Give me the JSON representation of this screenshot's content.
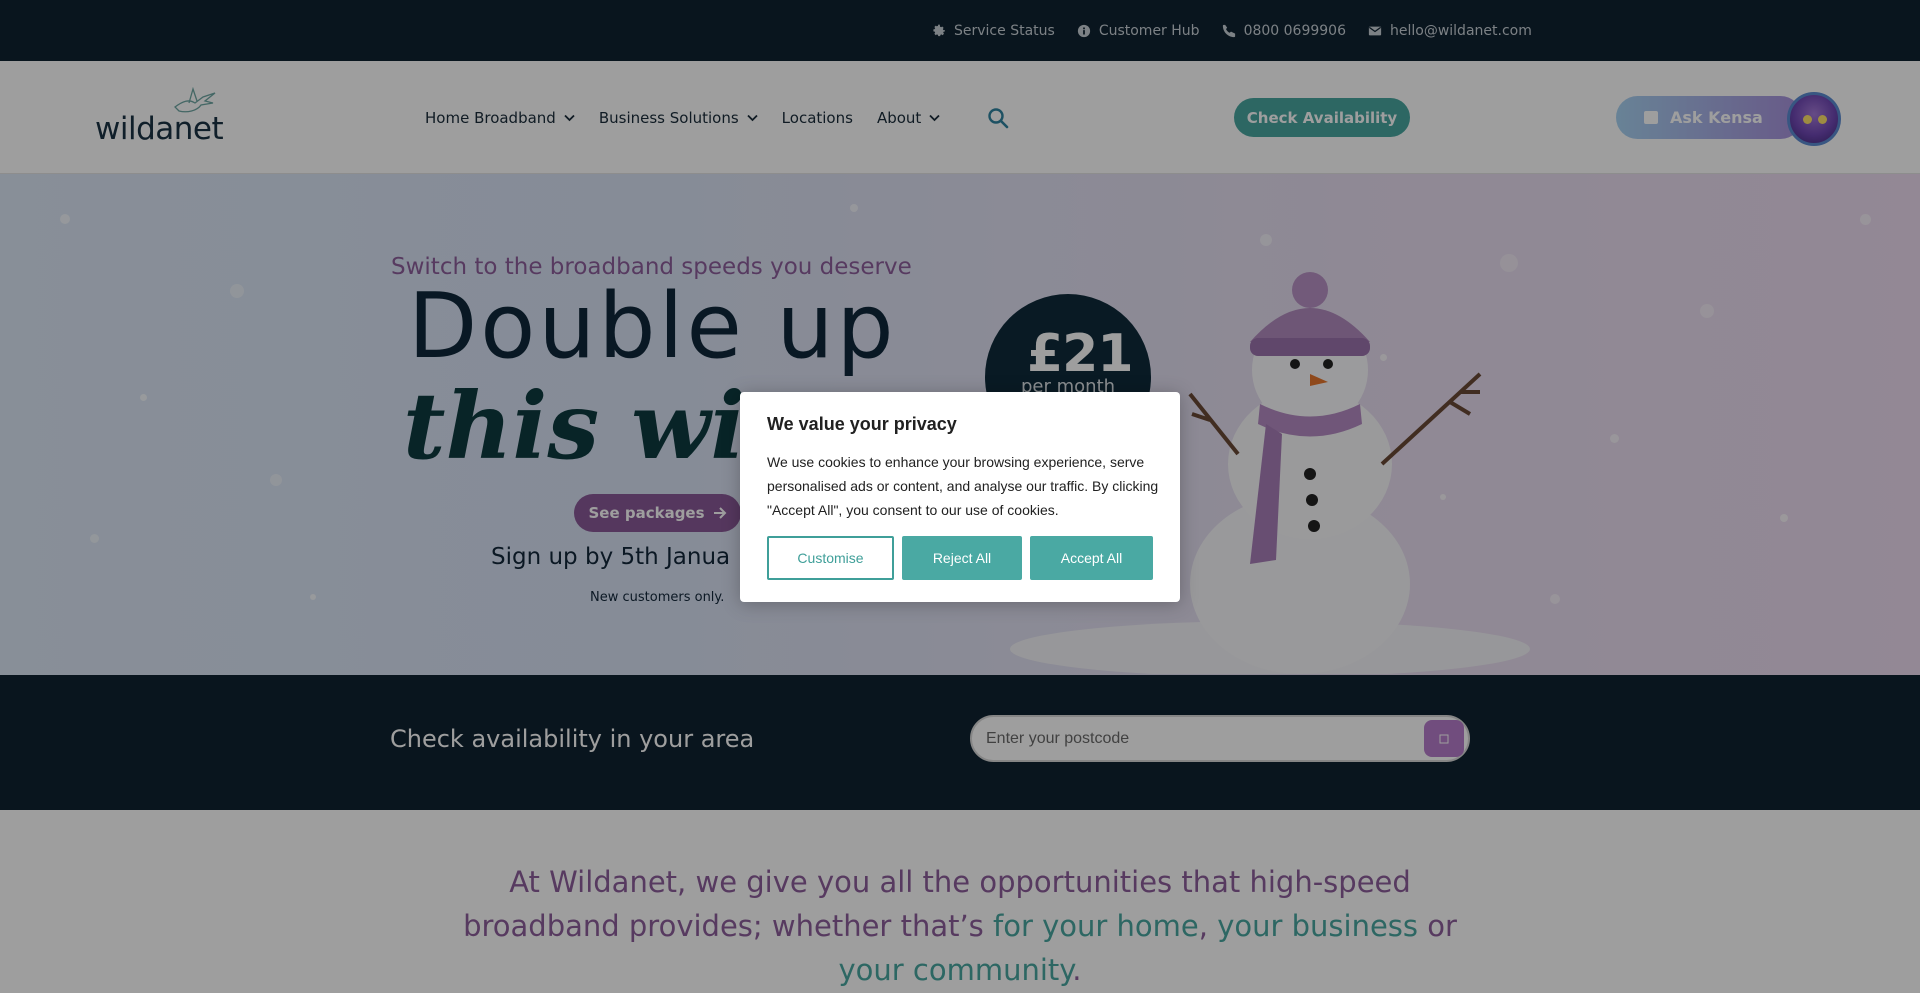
{
  "topbar": {
    "links": [
      {
        "label": "Service Status",
        "icon": "gear-icon"
      },
      {
        "label": "Customer Hub",
        "icon": "info-icon"
      },
      {
        "label": "0800 0699906",
        "icon": "phone-icon"
      },
      {
        "label": "hello@wildanet.com",
        "icon": "envelope-icon"
      }
    ]
  },
  "header": {
    "logo_text": "wildanet",
    "nav": [
      {
        "label": "Home Broadband",
        "has_dropdown": true
      },
      {
        "label": "Business Solutions",
        "has_dropdown": true
      },
      {
        "label": "Locations",
        "has_dropdown": false
      },
      {
        "label": "About",
        "has_dropdown": true
      }
    ],
    "check_availability": "Check Availability",
    "ask_kensa": "Ask Kensa"
  },
  "hero": {
    "kicker": "Switch to the broadband speeds you deserve",
    "headline_1": "Double up",
    "headline_2": "this win",
    "cta": "See packages",
    "signup": "Sign up by 5th Janua",
    "note": "New customers only.",
    "price_amount": "£21",
    "price_period": "per month"
  },
  "availability": {
    "label": "Check availability in your area",
    "placeholder": "Enter your postcode"
  },
  "intro": {
    "text_1": "At Wildanet, we give you all the opportunities that high-speed broadband provides; whether that’s ",
    "link_home": "for your home",
    "sep_1": ", ",
    "link_business": "your business",
    "sep_2": " or ",
    "link_community": "your community",
    "end": "."
  },
  "cookie": {
    "title": "We value your privacy",
    "body": "We use cookies to enhance your browsing experience, serve personalised ads or content, and analyse our traffic. By clicking \"Accept All\", you consent to our use of cookies.",
    "customise": "Customise",
    "reject": "Reject All",
    "accept": "Accept All"
  },
  "colors": {
    "navy": "#0f2231",
    "teal": "#4aa7a1",
    "purple": "#8d5e9b"
  }
}
